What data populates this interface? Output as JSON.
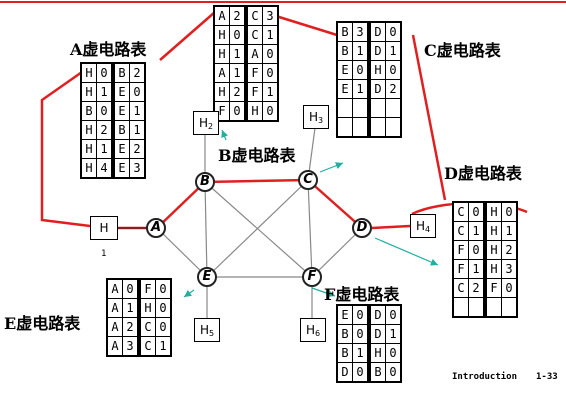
{
  "labels": {
    "A": "A虚电路表",
    "B": "B虚电路表",
    "C": "C虚电路表",
    "D": "D虚电路表",
    "E": "E虚电路表",
    "F": "F虚电路表"
  },
  "nodes": {
    "A": "A",
    "B": "B",
    "C": "C",
    "D": "D",
    "E": "E",
    "F": "F"
  },
  "hosts": {
    "H": "H",
    "H1": "1",
    "H2": "2",
    "H3": "3",
    "H4": "4",
    "H5": "5",
    "H6": "6"
  },
  "tables": {
    "A": [
      [
        "H",
        "0",
        "B",
        "2"
      ],
      [
        "H",
        "1",
        "E",
        "0"
      ],
      [
        "B",
        "0",
        "E",
        "1"
      ],
      [
        "H",
        "2",
        "B",
        "1"
      ],
      [
        "H",
        "1",
        "E",
        "2"
      ],
      [
        "H",
        "4",
        "E",
        "3"
      ]
    ],
    "B": [
      [
        "A",
        "2",
        "C",
        "3"
      ],
      [
        "H",
        "0",
        "C",
        "1"
      ],
      [
        "H",
        "1",
        "A",
        "0"
      ],
      [
        "A",
        "1",
        "F",
        "0"
      ],
      [
        "H",
        "2",
        "F",
        "1"
      ],
      [
        "F",
        "0",
        "H",
        "0"
      ]
    ],
    "C": [
      [
        "B",
        "3",
        "D",
        "0"
      ],
      [
        "B",
        "1",
        "D",
        "1"
      ],
      [
        "E",
        "0",
        "H",
        "0"
      ],
      [
        "E",
        "1",
        "D",
        "2"
      ],
      [
        "",
        "",
        "",
        ""
      ],
      [
        "",
        "",
        "",
        ""
      ]
    ],
    "D": [
      [
        "C",
        "0",
        "H",
        "0"
      ],
      [
        "C",
        "1",
        "H",
        "1"
      ],
      [
        "F",
        "0",
        "H",
        "2"
      ],
      [
        "F",
        "1",
        "H",
        "3"
      ],
      [
        "C",
        "2",
        "F",
        "0"
      ],
      [
        "",
        "",
        "",
        ""
      ]
    ],
    "E": [
      [
        "A",
        "0",
        "F",
        "0"
      ],
      [
        "A",
        "1",
        "H",
        "0"
      ],
      [
        "A",
        "2",
        "C",
        "0"
      ],
      [
        "A",
        "3",
        "C",
        "1"
      ]
    ],
    "F": [
      [
        "E",
        "0",
        "D",
        "0"
      ],
      [
        "B",
        "0",
        "D",
        "1"
      ],
      [
        "B",
        "1",
        "H",
        "0"
      ],
      [
        "D",
        "0",
        "B",
        "0"
      ]
    ]
  },
  "footer": {
    "title": "Introduction",
    "page": "1-33"
  },
  "colors": {
    "highlight": "#e02020",
    "arrow": "#20b0a0",
    "link": "#888888"
  }
}
